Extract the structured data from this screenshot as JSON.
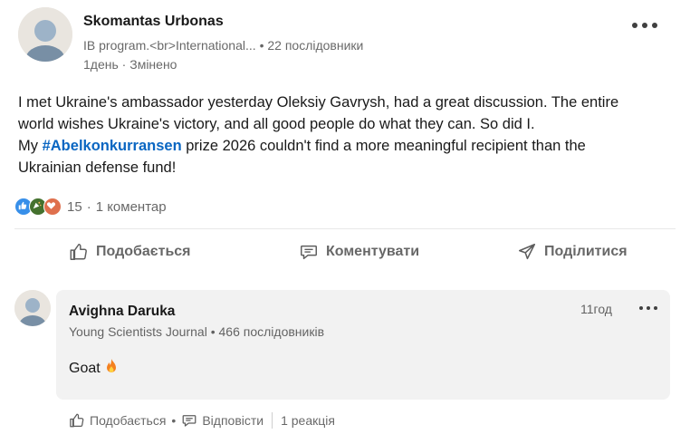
{
  "post": {
    "author": {
      "name": "Skomantas Urbonas",
      "headline": "IB program.<br>International...",
      "followers": "22 послідовники",
      "time": "1день",
      "edited": "Змінено"
    },
    "text": {
      "line1": "I met Ukraine's ambassador yesterday Oleksiy Gavrysh, had a great discussion. The entire",
      "line2": "world wishes Ukraine's victory, and all good people do what they can. So did I.",
      "line3_prefix": "My ",
      "hashtag": "#Abelkonkurransen",
      "line3_suffix": " prize 2026 couldn't find a more meaningful recipient than the",
      "line4": "Ukrainian defense fund!"
    },
    "reactions": {
      "count": "15",
      "comments": "1 коментар",
      "types": [
        "like-icon",
        "celebrate-icon",
        "love-icon"
      ]
    },
    "actions": {
      "like": "Подобається",
      "comment": "Коментувати",
      "share": "Поділитися"
    }
  },
  "comment": {
    "author": "Avighna Daruka",
    "headline": "Young Scientists Journal",
    "followers": "466 послідовників",
    "time": "11год",
    "text": "Goat",
    "emoji": "fire-icon",
    "actions": {
      "like": "Подобається",
      "reply": "Відповісти",
      "reactions": "1 реакція"
    }
  },
  "colors": {
    "link": "#0a66c2",
    "muted": "#666666",
    "comment_bg": "#f2f2f2",
    "like": "#378fe9",
    "celebrate": "#44712e",
    "love": "#df704d"
  }
}
